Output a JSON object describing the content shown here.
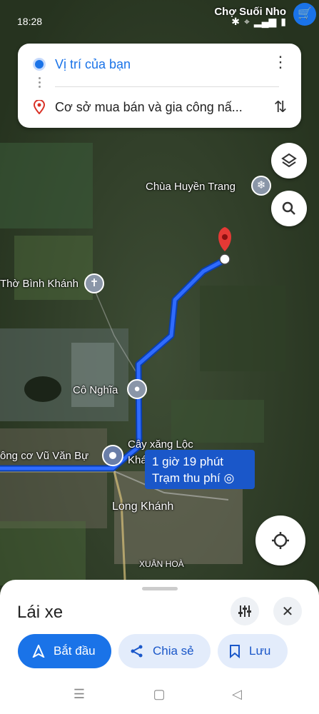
{
  "status_bar": {
    "time": "18:28",
    "top_place": "Chợ Suối Nho",
    "icons": [
      "bluetooth-icon",
      "location-icon",
      "signal-icon",
      "signal-icon",
      "battery-icon"
    ]
  },
  "directions": {
    "origin": "Vị trí của bạn",
    "destination": "Cơ sở mua bán và gia công nấ..."
  },
  "map_labels": {
    "chua": "Chùa Huyền Trang",
    "tho": "Thờ Bình Khánh",
    "co_nghia": "Cô Nghĩa",
    "cay_xang": "Cây xăng Lộc",
    "kha": "Khá",
    "dong_co": "ông cơ Vũ Văn Bự",
    "long_khanh": "Long Khánh",
    "xuan_hoa": "XUÂN HOÀ"
  },
  "route_info": {
    "duration": "1 giờ 19 phút",
    "toll": "Trạm thu phí"
  },
  "bottom_sheet": {
    "mode": "Lái xe",
    "start": "Bắt đầu",
    "share": "Chia sẻ",
    "save": "Lưu"
  },
  "colors": {
    "accent": "#1a73e8",
    "route": "#1a57c9",
    "pin": "#e53935"
  }
}
